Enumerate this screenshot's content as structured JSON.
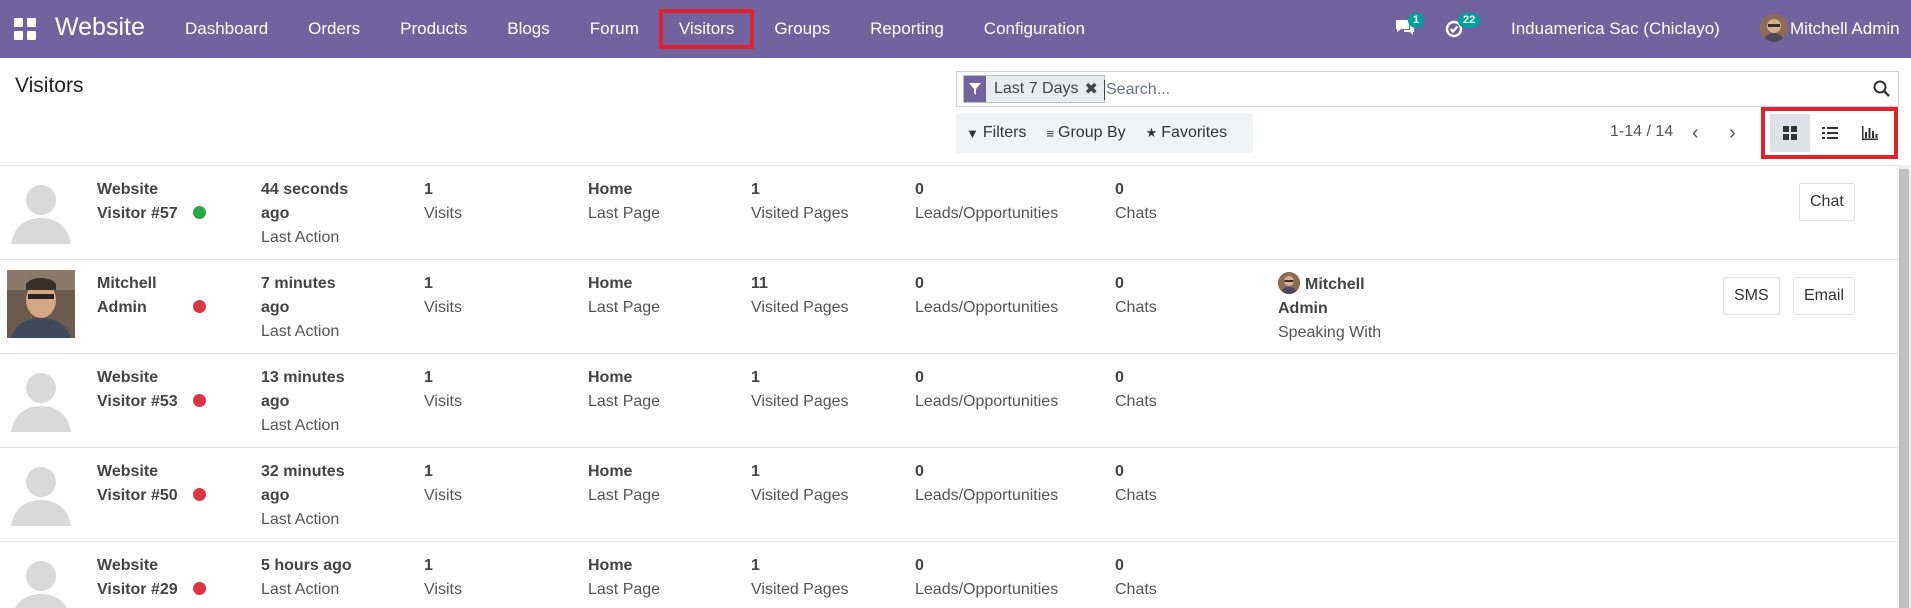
{
  "navbar": {
    "brand": "Website",
    "menu": [
      "Dashboard",
      "Orders",
      "Products",
      "Blogs",
      "Forum",
      "Visitors",
      "Groups",
      "Reporting",
      "Configuration"
    ],
    "highlighted_menu": "Visitors",
    "messages_count": "1",
    "activities_count": "22",
    "company": "Induamerica Sac (Chiclayo)",
    "user": "Mitchell Admin",
    "bg_color": "#71639e"
  },
  "control_panel": {
    "title": "Visitors",
    "facet_label": "Last 7 Days",
    "search_placeholder": "Search...",
    "filters_label": "Filters",
    "groupby_label": "Group By",
    "favorites_label": "Favorites",
    "pager": "1-14 / 14",
    "views": [
      "kanban",
      "list",
      "graph"
    ],
    "active_view": "kanban"
  },
  "visitors": [
    {
      "name_line1": "Website",
      "name_line2": "Visitor #57",
      "online": true,
      "time_line1": "44 seconds",
      "time_line2": "ago",
      "time_label": "Last Action",
      "visits": "1",
      "visits_label": "Visits",
      "last_page": "Home",
      "last_page_label": "Last Page",
      "visited_pages": "1",
      "visited_pages_label": "Visited Pages",
      "leads": "0",
      "leads_label": "Leads/Opportunities",
      "chats": "0",
      "chats_label": "Chats",
      "buttons": [
        "Chat"
      ]
    },
    {
      "name_line1": "Mitchell",
      "name_line2": "Admin",
      "online": false,
      "photo": true,
      "time_line1": "7 minutes",
      "time_line2": "ago",
      "time_label": "Last Action",
      "visits": "1",
      "visits_label": "Visits",
      "last_page": "Home",
      "last_page_label": "Last Page",
      "visited_pages": "11",
      "visited_pages_label": "Visited Pages",
      "leads": "0",
      "leads_label": "Leads/Opportunities",
      "chats": "0",
      "chats_label": "Chats",
      "speaking_line1": "Mitchell",
      "speaking_line2": "Admin",
      "speaking_label": "Speaking With",
      "buttons": [
        "SMS",
        "Email"
      ]
    },
    {
      "name_line1": "Website",
      "name_line2": "Visitor #53",
      "online": false,
      "time_line1": "13 minutes",
      "time_line2": "ago",
      "time_label": "Last Action",
      "visits": "1",
      "visits_label": "Visits",
      "last_page": "Home",
      "last_page_label": "Last Page",
      "visited_pages": "1",
      "visited_pages_label": "Visited Pages",
      "leads": "0",
      "leads_label": "Leads/Opportunities",
      "chats": "0",
      "chats_label": "Chats",
      "buttons": []
    },
    {
      "name_line1": "Website",
      "name_line2": "Visitor #50",
      "online": false,
      "time_line1": "32 minutes",
      "time_line2": "ago",
      "time_label": "Last Action",
      "visits": "1",
      "visits_label": "Visits",
      "last_page": "Home",
      "last_page_label": "Last Page",
      "visited_pages": "1",
      "visited_pages_label": "Visited Pages",
      "leads": "0",
      "leads_label": "Leads/Opportunities",
      "chats": "0",
      "chats_label": "Chats",
      "buttons": []
    },
    {
      "name_line1": "Website",
      "name_line2": "Visitor #29",
      "online": false,
      "time_line1": "5 hours ago",
      "time_line2": "",
      "time_label": "Last Action",
      "visits": "1",
      "visits_label": "Visits",
      "last_page": "Home",
      "last_page_label": "Last Page",
      "visited_pages": "1",
      "visited_pages_label": "Visited Pages",
      "leads": "0",
      "leads_label": "Leads/Opportunities",
      "chats": "0",
      "chats_label": "Chats",
      "buttons": []
    }
  ],
  "colors": {
    "online": "#28a745",
    "offline": "#dc3545",
    "accent": "#71639e",
    "highlight": "#e0212e"
  }
}
